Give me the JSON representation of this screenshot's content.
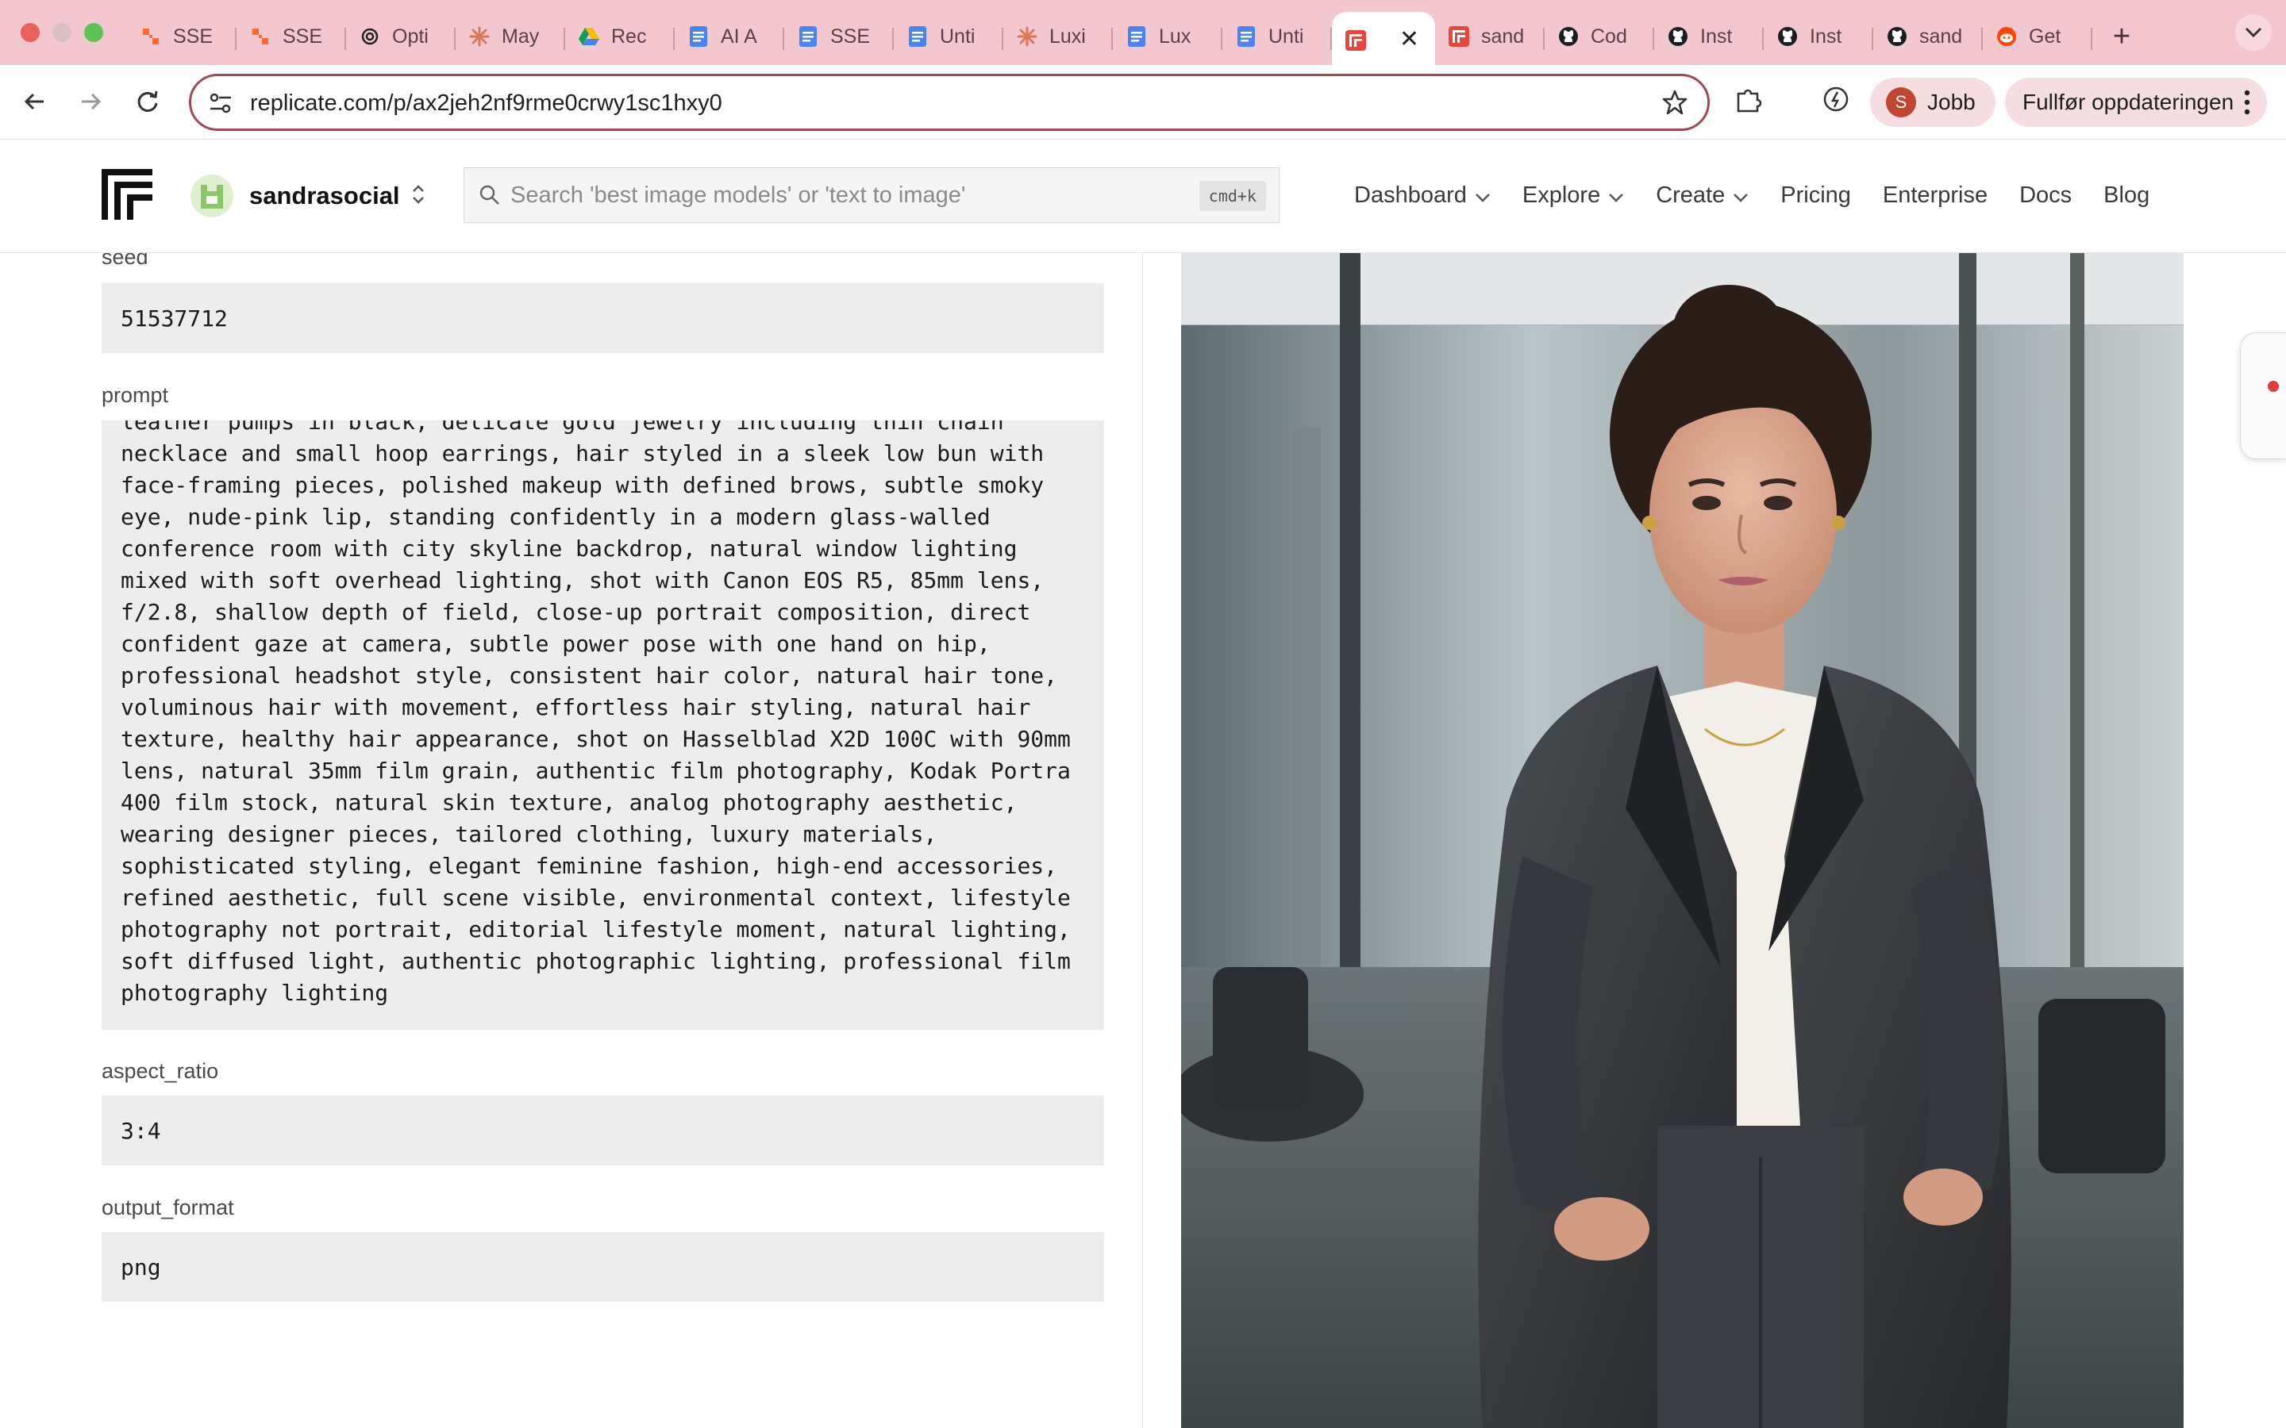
{
  "browser": {
    "tabs": [
      {
        "label": "SSE",
        "icon": "zapier-icon"
      },
      {
        "label": "SSE",
        "icon": "zapier-icon"
      },
      {
        "label": "Opti",
        "icon": "openai-icon"
      },
      {
        "label": "May",
        "icon": "claude-icon"
      },
      {
        "label": "Rec",
        "icon": "google-drive-icon"
      },
      {
        "label": "AI A",
        "icon": "google-docs-icon"
      },
      {
        "label": "SSE",
        "icon": "google-docs-icon"
      },
      {
        "label": "Unti",
        "icon": "google-docs-icon"
      },
      {
        "label": "Luxi",
        "icon": "claude-icon"
      },
      {
        "label": "Lux",
        "icon": "google-docs-icon"
      },
      {
        "label": "Unti",
        "icon": "google-docs-icon"
      },
      {
        "label": "",
        "icon": "replicate-icon",
        "active": true
      },
      {
        "label": "sand",
        "icon": "replicate-icon"
      },
      {
        "label": "Cod",
        "icon": "github-icon"
      },
      {
        "label": "Inst",
        "icon": "github-icon"
      },
      {
        "label": "Inst",
        "icon": "github-icon"
      },
      {
        "label": "sand",
        "icon": "github-icon"
      },
      {
        "label": "Get",
        "icon": "reddit-icon"
      }
    ],
    "close_tab_glyph": "✕",
    "new_tab_glyph": "+",
    "url": "replicate.com/p/ax2jeh2nf9rme0crwy1sc1hxy0",
    "profile": {
      "initial": "S",
      "label": "Jobb"
    },
    "update_label": "Fullfør oppdateringen"
  },
  "header": {
    "org_name": "sandrasocial",
    "search_placeholder": "Search 'best image models' or 'text to image'",
    "search_shortcut": "cmd+k",
    "nav": [
      {
        "label": "Dashboard",
        "dropdown": true
      },
      {
        "label": "Explore",
        "dropdown": true
      },
      {
        "label": "Create",
        "dropdown": true
      },
      {
        "label": "Pricing",
        "dropdown": false
      },
      {
        "label": "Enterprise",
        "dropdown": false
      },
      {
        "label": "Docs",
        "dropdown": false
      },
      {
        "label": "Blog",
        "dropdown": false
      }
    ]
  },
  "inputs": {
    "seed": {
      "label": "seed",
      "value": "51537712"
    },
    "prompt": {
      "label": "prompt",
      "value": "leather pumps in black, delicate gold jewelry including thin chain\nnecklace and small hoop earrings, hair styled in a sleek low bun with\nface-framing pieces, polished makeup with defined brows, subtle smoky\neye, nude-pink lip, standing confidently in a modern glass-walled\nconference room with city skyline backdrop, natural window lighting\nmixed with soft overhead lighting, shot with Canon EOS R5, 85mm lens,\nf/2.8, shallow depth of field, close-up portrait composition, direct\nconfident gaze at camera, subtle power pose with one hand on hip,\nprofessional headshot style, consistent hair color, natural hair tone,\nvoluminous hair with movement, effortless hair styling, natural hair\ntexture, healthy hair appearance, shot on Hasselblad X2D 100C with 90mm\nlens, natural 35mm film grain, authentic film photography, Kodak Portra\n400 film stock, natural skin texture, analog photography aesthetic,\nwearing designer pieces, tailored clothing, luxury materials,\nsophisticated styling, elegant feminine fashion, high-end accessories,\nrefined aesthetic, full scene visible, environmental context, lifestyle\nphotography not portrait, editorial lifestyle moment, natural lighting,\nsoft diffused light, authentic photographic lighting, professional film\nphotography lighting"
    },
    "aspect_ratio": {
      "label": "aspect_ratio",
      "value": "3:4"
    },
    "output_format": {
      "label": "output_format",
      "value": "png"
    }
  },
  "colors": {
    "tabstrip": "#f2c7cf",
    "omnibox_border": "#a14a55",
    "field_bg": "#ededed"
  }
}
